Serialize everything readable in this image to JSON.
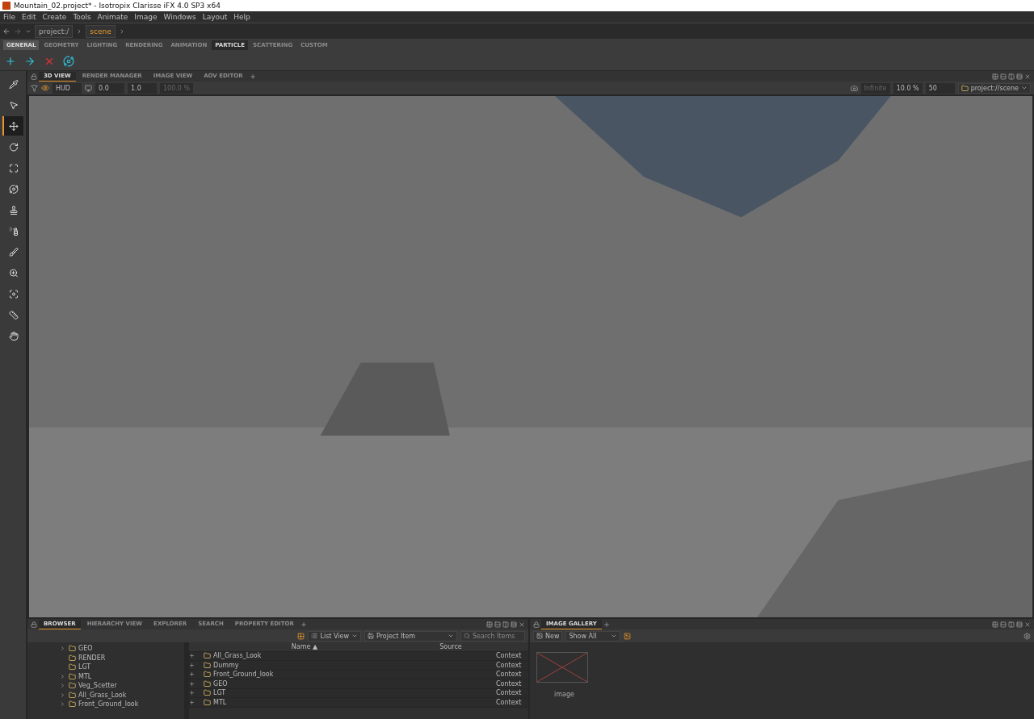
{
  "window": {
    "title": "Mountain_02.project* - Isotropix Clarisse iFX 4.0 SP3 x64"
  },
  "menu": [
    "File",
    "Edit",
    "Create",
    "Tools",
    "Animate",
    "Image",
    "Windows",
    "Layout",
    "Help"
  ],
  "path_bar": {
    "segments": [
      {
        "label": "project:/",
        "selected": false
      },
      {
        "label": "scene",
        "selected": true
      }
    ]
  },
  "shelf": {
    "tabs": [
      {
        "label": "GENERAL",
        "selected": false,
        "highlighted": true
      },
      {
        "label": "GEOMETRY",
        "selected": false,
        "highlighted": false
      },
      {
        "label": "LIGHTING",
        "selected": false,
        "highlighted": false
      },
      {
        "label": "RENDERING",
        "selected": false,
        "highlighted": false
      },
      {
        "label": "ANIMATION",
        "selected": false,
        "highlighted": false
      },
      {
        "label": "PARTICLE",
        "selected": true,
        "highlighted": false
      },
      {
        "label": "SCATTERING",
        "selected": false,
        "highlighted": false
      },
      {
        "label": "CUSTOM",
        "selected": false,
        "highlighted": false
      }
    ]
  },
  "tools": [
    {
      "kind": "pipette",
      "selected": false
    },
    {
      "kind": "pointer",
      "selected": false
    },
    {
      "kind": "move",
      "selected": true
    },
    {
      "kind": "rotate",
      "selected": false
    },
    {
      "kind": "scale",
      "selected": false
    },
    {
      "kind": "orbit",
      "selected": false
    },
    {
      "kind": "stamp",
      "selected": false
    },
    {
      "kind": "spray",
      "selected": false
    },
    {
      "kind": "brush",
      "selected": false
    },
    {
      "kind": "zoom",
      "selected": false
    },
    {
      "kind": "frame",
      "selected": false
    },
    {
      "kind": "ruler",
      "selected": false
    },
    {
      "kind": "hand",
      "selected": false
    }
  ],
  "viewport_panel": {
    "tabs": [
      {
        "label": "3D VIEW",
        "selected": true
      },
      {
        "label": "RENDER MANAGER",
        "selected": false
      },
      {
        "label": "IMAGE VIEW",
        "selected": false
      },
      {
        "label": "AOV EDITOR",
        "selected": false
      }
    ],
    "hud": "HUD",
    "exposure": "0.0",
    "gamma": "1.0",
    "zoom": {
      "value": "100.0 %",
      "disabled": true
    },
    "distance": {
      "placeholder": "Infinite"
    },
    "sampling": "10.0 %",
    "count": "50",
    "context": "project://scene"
  },
  "browser_panel": {
    "tabs": [
      {
        "label": "BROWSER",
        "selected": true
      },
      {
        "label": "HIERARCHY VIEW",
        "selected": false
      },
      {
        "label": "EXPLORER",
        "selected": false
      },
      {
        "label": "SEARCH",
        "selected": false
      },
      {
        "label": "PROPERTY EDITOR",
        "selected": false
      }
    ],
    "view_mode": "List View",
    "filter": "Project Item",
    "search": {
      "placeholder": "Search Items"
    },
    "tree": [
      {
        "label": "GEO",
        "expandable": true
      },
      {
        "label": "RENDER",
        "expandable": false
      },
      {
        "label": "LGT",
        "expandable": false
      },
      {
        "label": "MTL",
        "expandable": true
      },
      {
        "label": "Veg_Scetter",
        "expandable": true
      },
      {
        "label": "All_Grass_Look",
        "expandable": true
      },
      {
        "label": "Front_Ground_look",
        "expandable": true
      }
    ],
    "columns": [
      "Name ▲",
      "Source"
    ],
    "rows": [
      {
        "name": "All_Grass_Look",
        "type": "Context"
      },
      {
        "name": "Dummy",
        "type": "Context"
      },
      {
        "name": "Front_Ground_look",
        "type": "Context"
      },
      {
        "name": "GEO",
        "type": "Context"
      },
      {
        "name": "LGT",
        "type": "Context"
      },
      {
        "name": "MTL",
        "type": "Context"
      }
    ]
  },
  "gallery_panel": {
    "tabs": [
      {
        "label": "IMAGE GALLERY",
        "selected": true
      }
    ],
    "new_label": "New",
    "filter": "Show All",
    "images": [
      {
        "label": "image"
      }
    ]
  }
}
